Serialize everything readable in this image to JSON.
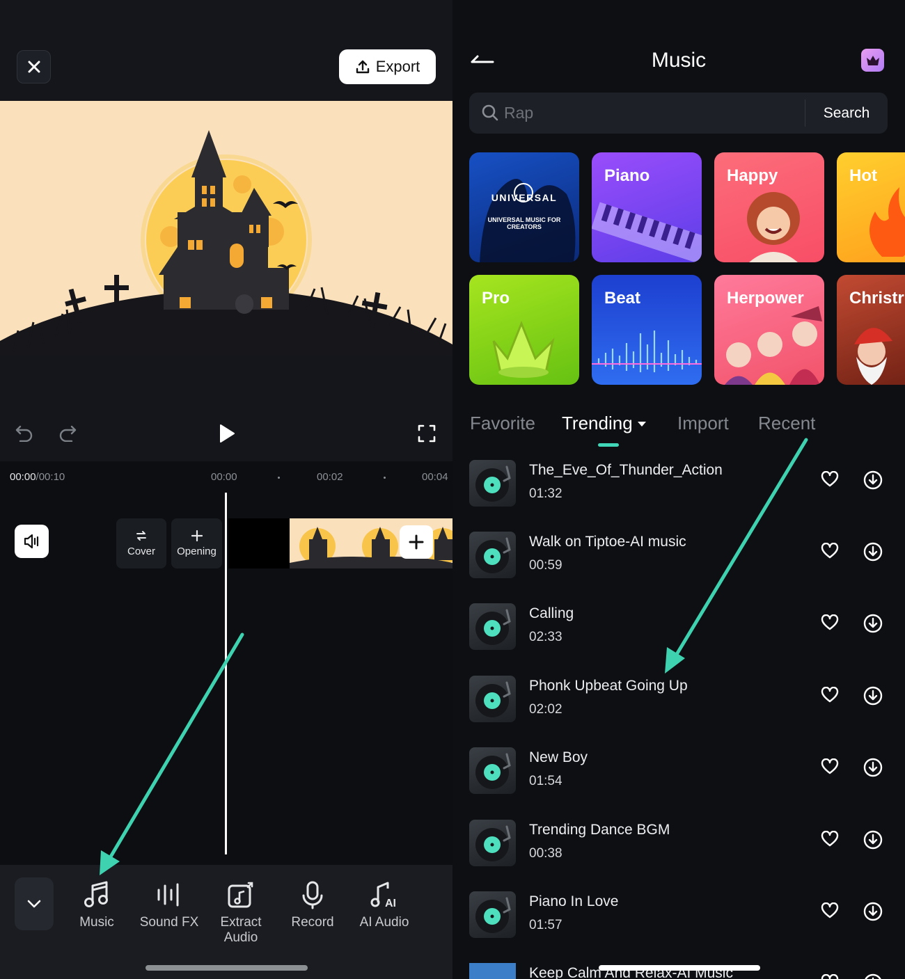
{
  "editor": {
    "export_label": "Export",
    "timecode_current": "00:00",
    "timecode_total": "/00:10",
    "ruler": [
      "00:00",
      "00:02",
      "00:04"
    ],
    "cover_label": "Cover",
    "opening_label": "Opening"
  },
  "toolbar": {
    "items": [
      {
        "label": "Music",
        "icon": "music-note-icon"
      },
      {
        "label": "Sound FX",
        "icon": "sound-wave-icon"
      },
      {
        "label": "Extract\nAudio",
        "icon": "extract-audio-icon"
      },
      {
        "label": "Record",
        "icon": "microphone-icon"
      },
      {
        "label": "AI Audio",
        "icon": "ai-audio-icon"
      }
    ]
  },
  "music": {
    "title": "Music",
    "search_placeholder": "Rap",
    "search_button": "Search",
    "universal_logo_text": "UNIVERSAL",
    "universal_sub": "UNIVERSAL MUSIC FOR CREATORS",
    "categories": [
      "Piano",
      "Happy",
      "Hot",
      "Pro",
      "Beat",
      "Herpower",
      "Christr"
    ],
    "tabs": [
      "Favorite",
      "Trending",
      "Import",
      "Recent"
    ],
    "active_tab": "Trending",
    "tracks": [
      {
        "name": "The_Eve_Of_Thunder_Action",
        "duration": "01:32"
      },
      {
        "name": "Walk on Tiptoe-AI music",
        "duration": "00:59"
      },
      {
        "name": "Calling",
        "duration": "02:33"
      },
      {
        "name": "Phonk Upbeat Going Up",
        "duration": "02:02"
      },
      {
        "name": "New Boy",
        "duration": "01:54"
      },
      {
        "name": "Trending Dance BGM",
        "duration": "00:38"
      },
      {
        "name": "Piano In Love",
        "duration": "01:57"
      },
      {
        "name": "Keep Calm And Relax-AI Music",
        "duration": ""
      }
    ]
  },
  "colors": {
    "accent": "#3fd7b8",
    "arrow": "#3fd2b0"
  }
}
